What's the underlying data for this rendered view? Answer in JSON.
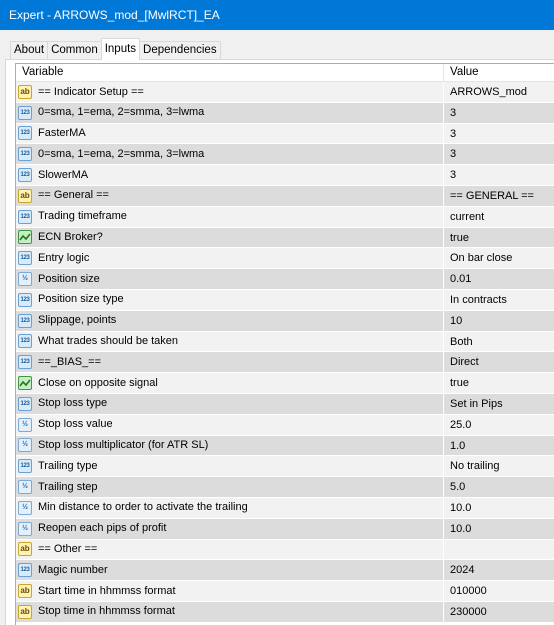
{
  "window": {
    "title": "Expert - ARROWS_mod_[MwlRCT]_EA"
  },
  "tabs": [
    {
      "label": "About",
      "active": false
    },
    {
      "label": "Common",
      "active": false
    },
    {
      "label": "Inputs",
      "active": true
    },
    {
      "label": "Dependencies",
      "active": false
    }
  ],
  "grid": {
    "columns": {
      "variable": "Variable",
      "value": "Value"
    },
    "rows": [
      {
        "icon": "string-icon",
        "type": "ab",
        "variable": "== Indicator Setup ==",
        "value": "ARROWS_mod"
      },
      {
        "icon": "integer-icon",
        "type": "123",
        "variable": "0=sma, 1=ema, 2=smma, 3=lwma",
        "value": "3"
      },
      {
        "icon": "integer-icon",
        "type": "123",
        "variable": "FasterMA",
        "value": "3"
      },
      {
        "icon": "integer-icon",
        "type": "123",
        "variable": "0=sma, 1=ema, 2=smma, 3=lwma",
        "value": "3"
      },
      {
        "icon": "integer-icon",
        "type": "123",
        "variable": "SlowerMA",
        "value": "3"
      },
      {
        "icon": "string-icon",
        "type": "ab",
        "variable": "== General ==",
        "value": "== GENERAL =="
      },
      {
        "icon": "integer-icon",
        "type": "123",
        "variable": "Trading timeframe",
        "value": "current"
      },
      {
        "icon": "boolean-icon",
        "type": "bool",
        "variable": "ECN Broker?",
        "value": "true"
      },
      {
        "icon": "integer-icon",
        "type": "123",
        "variable": "Entry logic",
        "value": "On bar close"
      },
      {
        "icon": "double-icon",
        "type": "frac",
        "variable": "Position size",
        "value": "0.01"
      },
      {
        "icon": "integer-icon",
        "type": "123",
        "variable": "Position size type",
        "value": "In contracts"
      },
      {
        "icon": "integer-icon",
        "type": "123",
        "variable": "Slippage, points",
        "value": "10"
      },
      {
        "icon": "integer-icon",
        "type": "123",
        "variable": "What trades should be taken",
        "value": "Both"
      },
      {
        "icon": "integer-icon",
        "type": "123",
        "variable": "==_BIAS_==",
        "value": "Direct"
      },
      {
        "icon": "boolean-icon",
        "type": "bool",
        "variable": "Close on opposite signal",
        "value": "true"
      },
      {
        "icon": "integer-icon",
        "type": "123",
        "variable": "Stop loss type",
        "value": "Set in Pips"
      },
      {
        "icon": "double-icon",
        "type": "frac",
        "variable": "Stop loss value",
        "value": "25.0"
      },
      {
        "icon": "double-icon",
        "type": "frac",
        "variable": "Stop loss multiplicator (for ATR SL)",
        "value": "1.0"
      },
      {
        "icon": "integer-icon",
        "type": "123",
        "variable": "Trailing type",
        "value": "No trailing"
      },
      {
        "icon": "double-icon",
        "type": "frac",
        "variable": "Trailing step",
        "value": "5.0"
      },
      {
        "icon": "double-icon",
        "type": "frac",
        "variable": "Min distance to order to activate the trailing",
        "value": "10.0"
      },
      {
        "icon": "double-icon",
        "type": "frac",
        "variable": "Reopen each pips of profit",
        "value": "10.0"
      },
      {
        "icon": "string-icon",
        "type": "ab",
        "variable": "== Other ==",
        "value": ""
      },
      {
        "icon": "integer-icon",
        "type": "123",
        "variable": "Magic number",
        "value": "2024"
      },
      {
        "icon": "string-icon",
        "type": "ab",
        "variable": "Start time in hhmmss format",
        "value": "010000"
      },
      {
        "icon": "string-icon",
        "type": "ab",
        "variable": "Stop time in hhmmss format",
        "value": "230000"
      }
    ]
  },
  "colors": {
    "titlebar": "#0078d7",
    "row_light": "#f2f2f2",
    "row_dark": "#dcdcdc",
    "dialog_bg": "#f0f0f0"
  }
}
